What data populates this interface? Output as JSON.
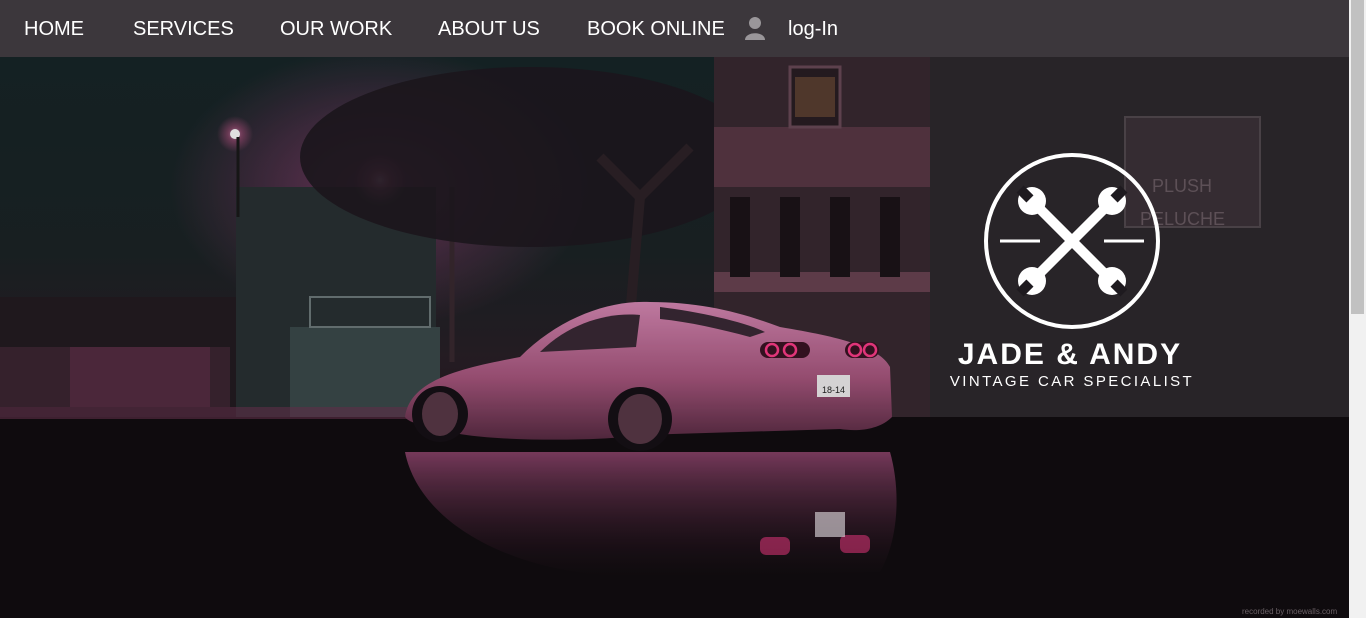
{
  "nav": {
    "items": [
      {
        "label": "HOME"
      },
      {
        "label": "SERVICES"
      },
      {
        "label": "OUR WORK"
      },
      {
        "label": "ABOUT US"
      },
      {
        "label": "BOOK ONLINE"
      }
    ],
    "login_label": "log-In",
    "login_icon": "user-icon"
  },
  "hero": {
    "logo_icon": "crossed-wrenches-icon",
    "brand_title": "JADE & ANDY",
    "brand_subtitle": "VINTAGE CAR SPECIALIST",
    "watermark": "recorded by moewalls.com",
    "building_sign_1": "PLUSH",
    "building_sign_2": "PELUCHE",
    "license_plate": "18-14"
  },
  "colors": {
    "nav_bg": "#3c373c",
    "nav_text": "#ffffff",
    "accent_pink": "#e0629c"
  }
}
